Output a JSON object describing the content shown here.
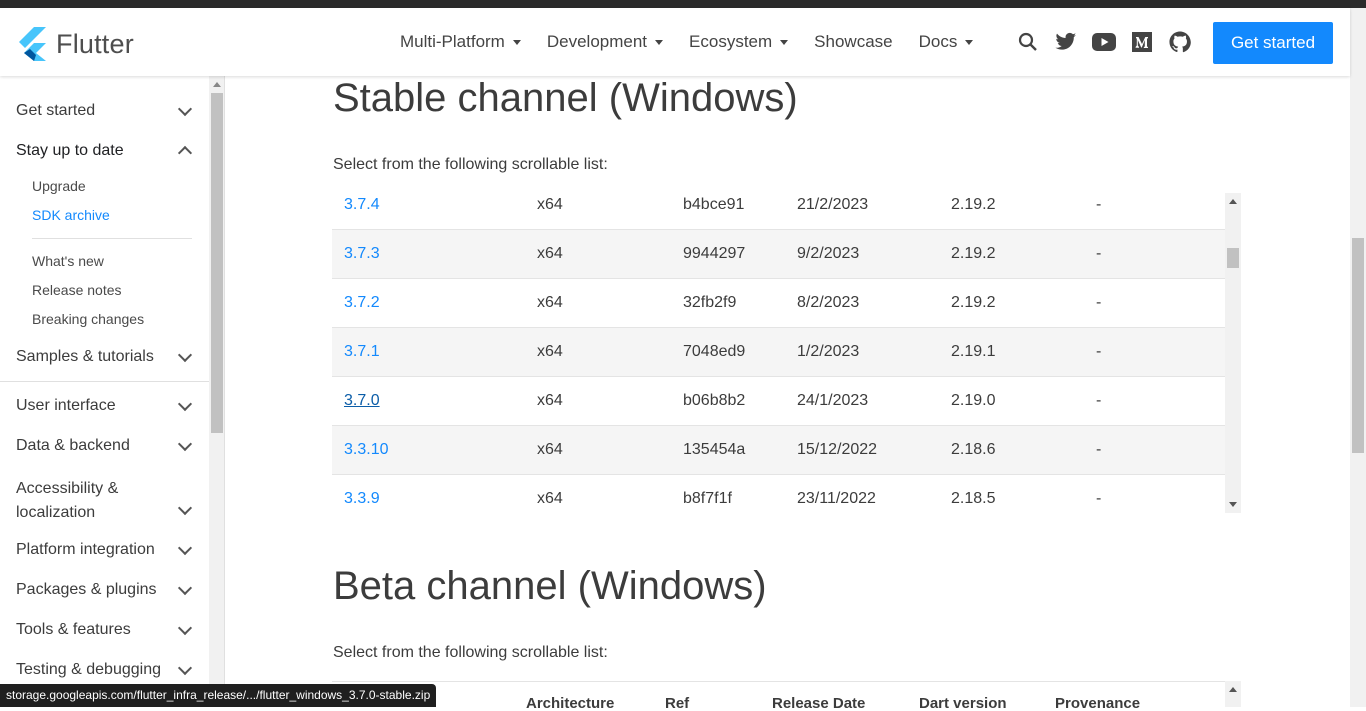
{
  "header": {
    "logo_text": "Flutter",
    "nav": [
      {
        "label": "Multi-Platform",
        "dropdown": true
      },
      {
        "label": "Development",
        "dropdown": true
      },
      {
        "label": "Ecosystem",
        "dropdown": true
      },
      {
        "label": "Showcase",
        "dropdown": false
      },
      {
        "label": "Docs",
        "dropdown": true
      }
    ],
    "icons": [
      "search-icon",
      "twitter-icon",
      "youtube-icon",
      "medium-icon",
      "github-icon"
    ],
    "cta_label": "Get started",
    "cta_color": "#1389fd"
  },
  "sidebar": {
    "items": {
      "get_started": "Get started",
      "stay_up_to_date": "Stay up to date",
      "samples": "Samples & tutorials",
      "user_interface": "User interface",
      "data_backend": "Data & backend",
      "accessibility_1": "Accessibility &",
      "accessibility_2": "localization",
      "platform": "Platform integration",
      "packages": "Packages & plugins",
      "tools": "Tools & features",
      "testing": "Testing & debugging"
    },
    "subitems": {
      "upgrade": "Upgrade",
      "sdk_archive": "SDK archive",
      "whats_new": "What's new",
      "release_notes": "Release notes",
      "breaking_changes": "Breaking changes"
    }
  },
  "content": {
    "stable_heading": "Stable channel (Windows)",
    "stable_intro": "Select from the following scrollable list:",
    "beta_heading": "Beta channel (Windows)",
    "beta_intro": "Select from the following scrollable list:",
    "stable_rows": [
      {
        "version": "3.7.4",
        "arch": "x64",
        "ref": "b4bce91",
        "date": "21/2/2023",
        "dart": "2.19.2",
        "prov": "-"
      },
      {
        "version": "3.7.3",
        "arch": "x64",
        "ref": "9944297",
        "date": "9/2/2023",
        "dart": "2.19.2",
        "prov": "-"
      },
      {
        "version": "3.7.2",
        "arch": "x64",
        "ref": "32fb2f9",
        "date": "8/2/2023",
        "dart": "2.19.2",
        "prov": "-"
      },
      {
        "version": "3.7.1",
        "arch": "x64",
        "ref": "7048ed9",
        "date": "1/2/2023",
        "dart": "2.19.1",
        "prov": "-"
      },
      {
        "version": "3.7.0",
        "arch": "x64",
        "ref": "b06b8b2",
        "date": "24/1/2023",
        "dart": "2.19.0",
        "prov": "-"
      },
      {
        "version": "3.3.10",
        "arch": "x64",
        "ref": "135454a",
        "date": "15/12/2022",
        "dart": "2.18.6",
        "prov": "-"
      },
      {
        "version": "3.3.9",
        "arch": "x64",
        "ref": "b8f7f1f",
        "date": "23/11/2022",
        "dart": "2.18.5",
        "prov": "-"
      }
    ],
    "beta_headers": {
      "arch": "Architecture",
      "ref": "Ref",
      "date": "Release Date",
      "dart": "Dart version",
      "prov": "Provenance"
    }
  },
  "status_url": "storage.googleapis.com/flutter_infra_release/.../flutter_windows_3.7.0-stable.zip"
}
